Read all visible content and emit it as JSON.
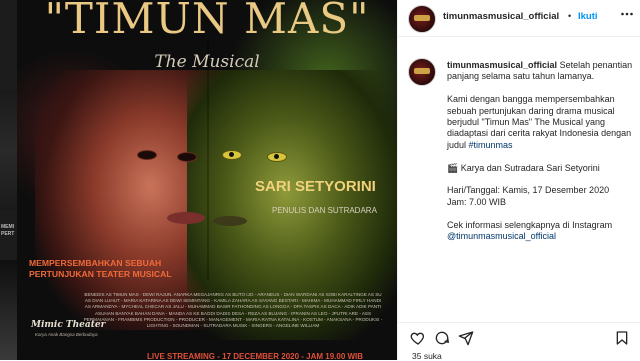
{
  "left_edge": {
    "lines": [
      "MEMI",
      "PERT"
    ]
  },
  "poster": {
    "title": "\"TIMUN MAS\"",
    "subtitle": "The Musical",
    "name": "SARI SETYORINI",
    "role": "PENULIS DAN SUTRADARA",
    "present_line1": "MEMPERSEMBAHKAN SEBUAH",
    "present_line2": "PERTUNJUKAN TEATER MUSICAL",
    "credits": "BENEDIS AS TIMUN MAS - DEWI RAJUN. ANARKA MEGAJANRIG AS BUTO IJO - ARANEUS - DIAN WARDANI AS SOBI KARALTINGE AS SU AS DIAN LUHUT - MARIA KATARINA AS DEWI SEMINTANG - KAMILA ZAHARA AS SAYANG BESTARI - MAHIMA - MUHAMMAD FIRLY HANDI AS ARMANDYA - MYCHEAL CHECAR AS JALU - MUHAMMAD BASIR FATHONDING AS LONGGA - DPA TASPIK AS DACA - ADIK ADIK PANTI ASUHAN BANYAK BAHAN DANA - MANDA AS KE BAGDI DADIS DESA - REZA AS BUJANG - IPRANIN AS LEO - JPUTRI ARE - ASS PERMAIANAN - FRAMBIMS PRODUCTION - PRODUCER - MANAGEMENT - MARIA RATNA KATALINA - KOSTUM - ANAKSANA - PRODUKSI - LIGHTING - SOUNDMAN - SUTRADARA MUSIK - SINGERS - ANGELINE WILLIAM",
    "mimic_title": "Mimic Theater",
    "mimic_sub": "Karya Anak Bangsa Berbudaya",
    "live": "LIVE STREAMING - 17 DECEMBER 2020 - JAM 19.00 WIB"
  },
  "header": {
    "username": "timunmasmusical_official",
    "separator": "•",
    "follow_label": "Ikuti",
    "more_icon": "more-horizontal-icon"
  },
  "caption": {
    "username": "timunmasmusical_official",
    "line1": "Setelah penantian panjang selama satu tahun lamanya.",
    "para2": "Kami dengan bangga mempersembahkan sebuah pertunjukan daring drama musical berjudul \"Timun Mas\" The Musical yang diadaptasi dari cerita rakyat Indonesia dengan judul",
    "hashtag": "#timunmas",
    "para3": "🎬 Karya dan Sutradara Sari Setyorini",
    "date_line": "Hari/Tanggal: Kamis, 17 Desember 2020",
    "time_line": "Jam: 7.00 WIB",
    "info_line": "Cek informasi selengkapnya di Instagram",
    "mention": "@timunmasmusical_official"
  },
  "footer": {
    "likes": "35 suka"
  },
  "colors": {
    "follow_blue": "#0095f6",
    "link_blue": "#00376b",
    "title_gold": "#e9c983",
    "accent_orange": "#f06a3a"
  }
}
